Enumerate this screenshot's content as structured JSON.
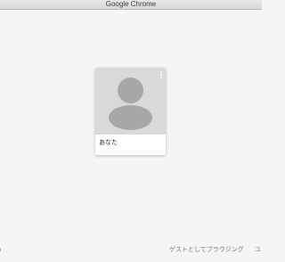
{
  "window": {
    "title": "Google Chrome"
  },
  "profile_card": {
    "name": "あなた",
    "avatar_icon": "default-person-avatar",
    "menu_icon": "vertical-dots-icon"
  },
  "footer": {
    "left_fragment": "n",
    "guest_label": "ゲストとしてブラウジング",
    "right_fragment": "ユ"
  }
}
